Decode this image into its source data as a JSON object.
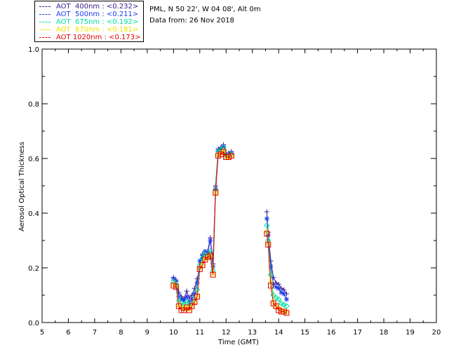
{
  "legend": [
    {
      "label": "AOT  400nm : <0.232>",
      "color": "#3a1a8f"
    },
    {
      "label": "AOT  500nm : <0.211>",
      "color": "#1c3cf0"
    },
    {
      "label": "AOT  675nm : <0.192>",
      "color": "#00e0a0"
    },
    {
      "label": "AOT  870nm : <0.181>",
      "color": "#f0e000"
    },
    {
      "label": "AOT 1020nm : <0.173>",
      "color": "#e00000"
    }
  ],
  "info": {
    "site": "PML, N 50 22', W 04 08', Alt 0m",
    "date": "Data from: 26 Nov 2018"
  },
  "chart_data": {
    "type": "line",
    "xlabel": "Time (GMT)",
    "ylabel": "Aerosol Optical Thickness",
    "xlim": [
      5,
      20
    ],
    "ylim": [
      0.0,
      1.0
    ],
    "x_ticks": [
      "5",
      "6",
      "7",
      "8",
      "9",
      "10",
      "11",
      "12",
      "13",
      "14",
      "15",
      "16",
      "17",
      "18",
      "19",
      "20"
    ],
    "y_ticks": [
      "0.0",
      "0.2",
      "0.4",
      "0.6",
      "0.8",
      "1.0"
    ],
    "grid": false,
    "segments": [
      {
        "x": [
          10.0,
          10.1,
          10.2,
          10.3,
          10.4,
          10.5,
          10.6,
          10.7,
          10.8,
          10.9,
          11.0,
          11.1,
          11.2,
          11.3,
          11.4,
          11.5,
          11.6,
          11.7,
          11.8,
          11.9,
          12.0,
          12.1,
          12.2
        ],
        "series": [
          {
            "name": "AOT  400nm",
            "values": [
              0.165,
              0.155,
              0.11,
              0.095,
              0.085,
              0.115,
              0.09,
              0.1,
              0.125,
              0.16,
              0.2,
              0.25,
              0.26,
              0.26,
              0.31,
              0.215,
              0.5,
              0.635,
              0.64,
              0.65,
              0.62,
              0.62,
              0.625
            ]
          },
          {
            "name": "AOT  500nm",
            "values": [
              0.16,
              0.15,
              0.095,
              0.085,
              0.08,
              0.095,
              0.075,
              0.085,
              0.105,
              0.145,
              0.225,
              0.245,
              0.26,
              0.255,
              0.3,
              0.205,
              0.49,
              0.63,
              0.635,
              0.645,
              0.615,
              0.615,
              0.62
            ]
          },
          {
            "name": "AOT  675nm",
            "values": [
              0.15,
              0.14,
              0.08,
              0.07,
              0.065,
              0.075,
              0.06,
              0.07,
              0.085,
              0.12,
              0.21,
              0.235,
              0.25,
              0.245,
              0.26,
              0.19,
              0.485,
              0.625,
              0.63,
              0.64,
              0.61,
              0.61,
              0.615
            ]
          },
          {
            "name": "AOT  870nm",
            "values": [
              0.14,
              0.135,
              0.065,
              0.055,
              0.05,
              0.06,
              0.05,
              0.06,
              0.075,
              0.1,
              0.2,
              0.215,
              0.235,
              0.24,
              0.245,
              0.18,
              0.475,
              0.615,
              0.62,
              0.63,
              0.605,
              0.605,
              0.61
            ]
          },
          {
            "name": "AOT 1020nm",
            "values": [
              0.135,
              0.13,
              0.06,
              0.045,
              0.045,
              0.055,
              0.045,
              0.06,
              0.075,
              0.095,
              0.195,
              0.21,
              0.23,
              0.24,
              0.245,
              0.175,
              0.475,
              0.61,
              0.615,
              0.625,
              0.605,
              0.605,
              0.61
            ]
          }
        ]
      },
      {
        "x": [
          13.55,
          13.6,
          13.7,
          13.8,
          13.9,
          14.0,
          14.1,
          14.2,
          14.3
        ],
        "series": [
          {
            "name": "AOT  400nm",
            "values": [
              0.405,
              0.33,
              0.225,
              0.165,
              0.145,
              0.14,
              0.125,
              0.12,
              0.105
            ]
          },
          {
            "name": "AOT  500nm",
            "values": [
              0.38,
              0.32,
              0.205,
              0.14,
              0.13,
              0.125,
              0.11,
              0.105,
              0.085
            ]
          },
          {
            "name": "AOT  675nm",
            "values": [
              0.355,
              0.3,
              0.175,
              0.1,
              0.09,
              0.085,
              0.07,
              0.065,
              0.06
            ]
          },
          {
            "name": "AOT  870nm",
            "values": [
              0.335,
              0.29,
              0.15,
              0.075,
              0.06,
              0.055,
              0.045,
              0.04,
              0.04
            ]
          },
          {
            "name": "AOT 1020nm",
            "values": [
              0.325,
              0.285,
              0.135,
              0.07,
              0.06,
              0.045,
              0.04,
              0.04,
              0.035
            ]
          }
        ]
      }
    ]
  }
}
